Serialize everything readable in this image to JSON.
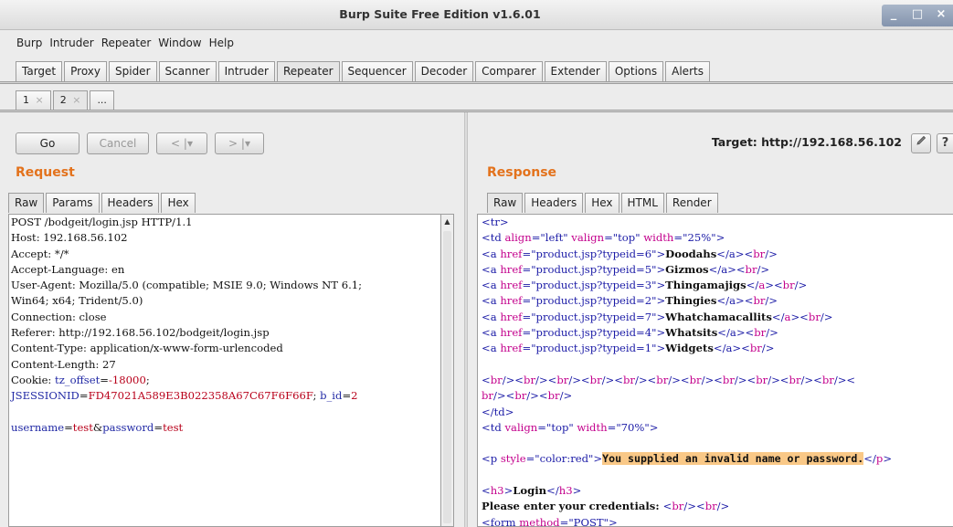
{
  "window": {
    "title": "Burp Suite Free Edition v1.6.01",
    "controls": [
      "_",
      "□",
      "×"
    ]
  },
  "menu": [
    "Burp",
    "Intruder",
    "Repeater",
    "Window",
    "Help"
  ],
  "main_tabs": [
    "Target",
    "Proxy",
    "Spider",
    "Scanner",
    "Intruder",
    "Repeater",
    "Sequencer",
    "Decoder",
    "Comparer",
    "Extender",
    "Options",
    "Alerts"
  ],
  "active_main_tab": "Repeater",
  "repeater_tabs": [
    {
      "label": "1",
      "close": "×"
    },
    {
      "label": "2",
      "close": "×"
    },
    {
      "label": "...",
      "close": ""
    }
  ],
  "toolbar": {
    "go": "Go",
    "cancel": "Cancel",
    "back": "< |▾",
    "forward": "> |▾",
    "target": "Target: http://192.168.56.102",
    "edit_icon": "pencil-icon",
    "help_icon": "?"
  },
  "request": {
    "title": "Request",
    "tabs": [
      "Raw",
      "Params",
      "Headers",
      "Hex"
    ],
    "lines": [
      "POST /bodgeit/login.jsp HTTP/1.1",
      "Host: 192.168.56.102",
      "Accept: */*",
      "Accept-Language: en",
      "User-Agent: Mozilla/5.0 (compatible; MSIE 9.0; Windows NT 6.1;",
      "Win64; x64; Trident/5.0)",
      "Connection: close",
      "Referer: http://192.168.56.102/bodgeit/login.jsp",
      "Content-Type: application/x-www-form-urlencoded",
      "Content-Length: 27"
    ],
    "cookie_label": "Cookie: ",
    "cookie_name1": "tz_offset",
    "cookie_val1": "-18000",
    "cookie_name2": "JSESSIONID",
    "cookie_val2": "FD47021A589E3B022358A67C67F6F66F",
    "cookie_name3": "b_id",
    "cookie_val3": "2",
    "body_name1": "username",
    "body_val1": "test",
    "body_name2": "password",
    "body_val2": "test"
  },
  "response": {
    "title": "Response",
    "tabs": [
      "Raw",
      "Headers",
      "Hex",
      "HTML",
      "Render"
    ],
    "links": [
      {
        "href": "\"product.jsp?typeid=6\"",
        "text": "Doodahs"
      },
      {
        "href": "\"product.jsp?typeid=5\"",
        "text": "Gizmos"
      },
      {
        "href": "\"product.jsp?typeid=3\"",
        "text": "Thingamajigs"
      },
      {
        "href": "\"product.jsp?typeid=2\"",
        "text": "Thingies"
      },
      {
        "href": "\"product.jsp?typeid=7\"",
        "text": "Whatchamacallits"
      },
      {
        "href": "\"product.jsp?typeid=4\"",
        "text": "Whatsits"
      },
      {
        "href": "\"product.jsp?typeid=1\"",
        "text": "Widgets"
      }
    ],
    "td1": {
      "align": "\"left\"",
      "valign": "\"top\"",
      "width": "\"25%\""
    },
    "td2": {
      "valign": "\"top\"",
      "width": "\"70%\""
    },
    "p_style": "\"color:red\"",
    "error_message": "You supplied an invalid name or password.",
    "h3_text": "Login",
    "prompt_text": "Please enter your credentials: ",
    "form_method": "\"POST\""
  }
}
